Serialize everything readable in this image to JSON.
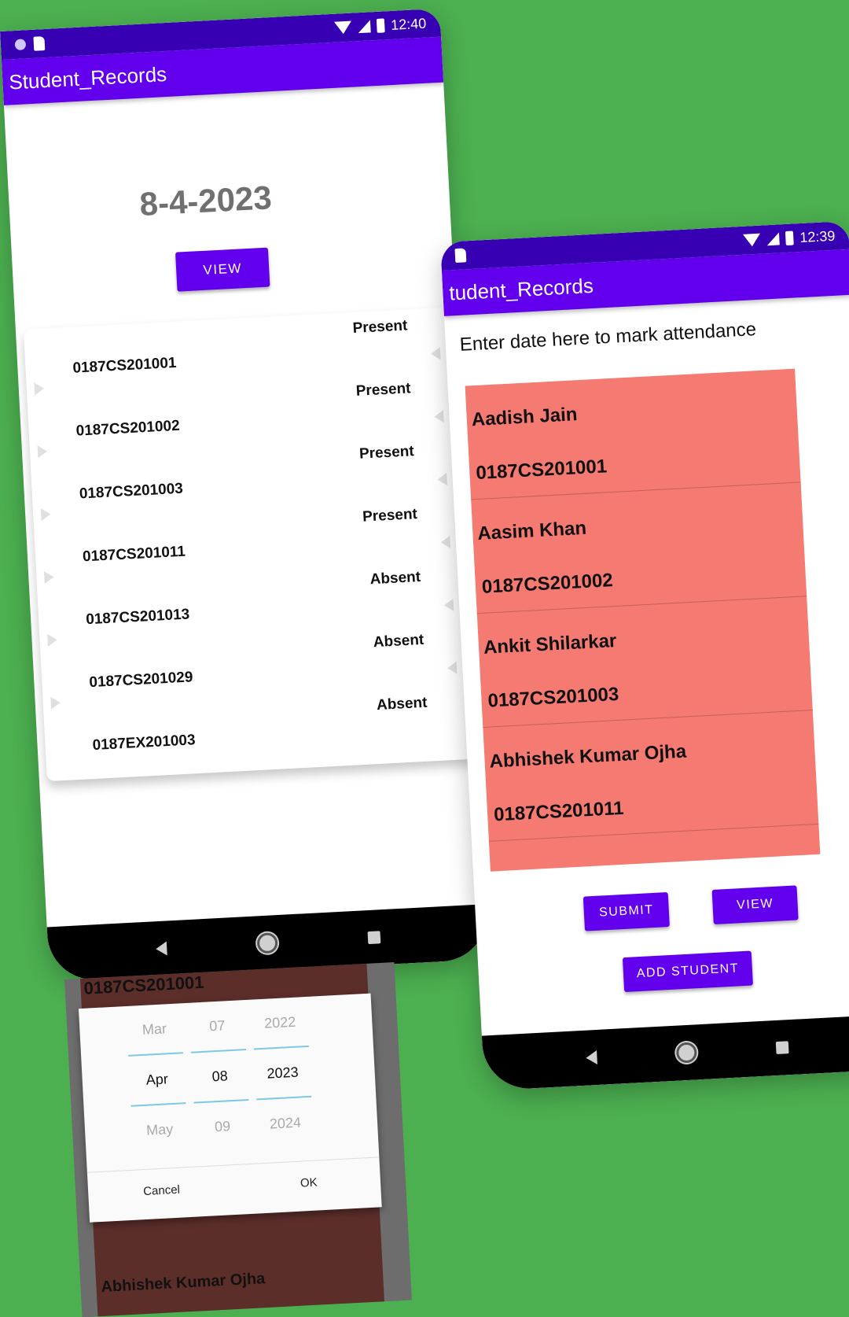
{
  "phone_view": {
    "status": {
      "time": "12:40"
    },
    "app_title": "Student_Records",
    "date": "8-4-2023",
    "view_label": "VIEW",
    "rows": [
      {
        "roll": "0187CS201001",
        "status": "Present"
      },
      {
        "roll": "0187CS201002",
        "status": "Present"
      },
      {
        "roll": "0187CS201003",
        "status": "Present"
      },
      {
        "roll": "0187CS201011",
        "status": "Present"
      },
      {
        "roll": "0187CS201013",
        "status": "Absent"
      },
      {
        "roll": "0187CS201029",
        "status": "Absent"
      },
      {
        "roll": "0187EX201003",
        "status": "Absent"
      }
    ]
  },
  "phone_mark": {
    "status": {
      "time": "12:39"
    },
    "app_title": "tudent_Records",
    "prompt": "Enter date here to mark attendance",
    "students": [
      {
        "name": "Aadish Jain",
        "roll": "0187CS201001"
      },
      {
        "name": "Aasim Khan",
        "roll": "0187CS201002"
      },
      {
        "name": "Ankit Shilarkar",
        "roll": "0187CS201003"
      },
      {
        "name": "Abhishek Kumar Ojha",
        "roll": "0187CS201011"
      }
    ],
    "submit_label": "SUBMIT",
    "view_label": "VIEW",
    "add_label": "ADD STUDENT"
  },
  "date_picker": {
    "bg_top_text": "0187CS201001",
    "bg_bottom_text": "Abhishek Kumar Ojha",
    "months": [
      "Mar",
      "Apr",
      "May"
    ],
    "days": [
      "07",
      "08",
      "09"
    ],
    "years": [
      "2022",
      "2023",
      "2024"
    ],
    "cancel_label": "Cancel",
    "ok_label": "OK"
  }
}
